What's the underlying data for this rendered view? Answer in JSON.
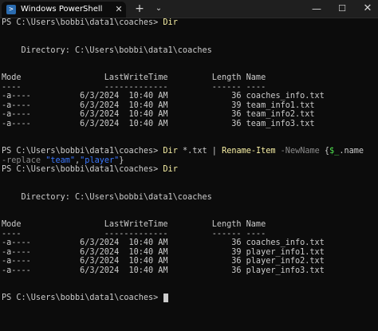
{
  "window": {
    "tab_title": "Windows PowerShell",
    "tab_icon": "powershell-icon",
    "close_tab": "✕",
    "new_tab": "+",
    "dropdown": "⌄",
    "minimize": "—",
    "maximize": "☐",
    "close": "✕"
  },
  "colors": {
    "background": "#0c0c0c",
    "text": "#cccccc",
    "command": "#f9f1a5",
    "parameter": "#8a8a8a",
    "string": "#3b78ff",
    "variable": "#4fe24f",
    "titlebar": "#1f1f1f"
  },
  "terminal": {
    "prompt": "PS C:\\Users\\bobbi\\data1\\coaches>",
    "cmd1": "Dir",
    "directory1": "    Directory: C:\\Users\\bobbi\\data1\\coaches",
    "header1": "Mode                 LastWriteTime         Length Name",
    "dashes1": "----                 -------------         ------ ----",
    "files1": [
      "-a----          6/3/2024  10:40 AM             36 coaches_info.txt",
      "-a----          6/3/2024  10:40 AM             39 team_info1.txt",
      "-a----          6/3/2024  10:40 AM             36 team_info2.txt",
      "-a----          6/3/2024  10:40 AM             36 team_info3.txt"
    ],
    "cmd2": {
      "dir": "Dir",
      "arg": "*.txt",
      "pipe": "|",
      "rename": "Rename-Item",
      "newname_param": "-NewName",
      "brace_open": "{",
      "var": "$_",
      "prop": ".name",
      "replace_op": "-replace",
      "str1": "\"team\"",
      "comma": ",",
      "str2": "\"player\"",
      "brace_close": "}"
    },
    "cmd3": "Dir",
    "directory2": "    Directory: C:\\Users\\bobbi\\data1\\coaches",
    "header2": "Mode                 LastWriteTime         Length Name",
    "dashes2": "----                 -------------         ------ ----",
    "files2": [
      "-a----          6/3/2024  10:40 AM             36 coaches_info.txt",
      "-a----          6/3/2024  10:40 AM             39 player_info1.txt",
      "-a----          6/3/2024  10:40 AM             36 player_info2.txt",
      "-a----          6/3/2024  10:40 AM             36 player_info3.txt"
    ]
  }
}
